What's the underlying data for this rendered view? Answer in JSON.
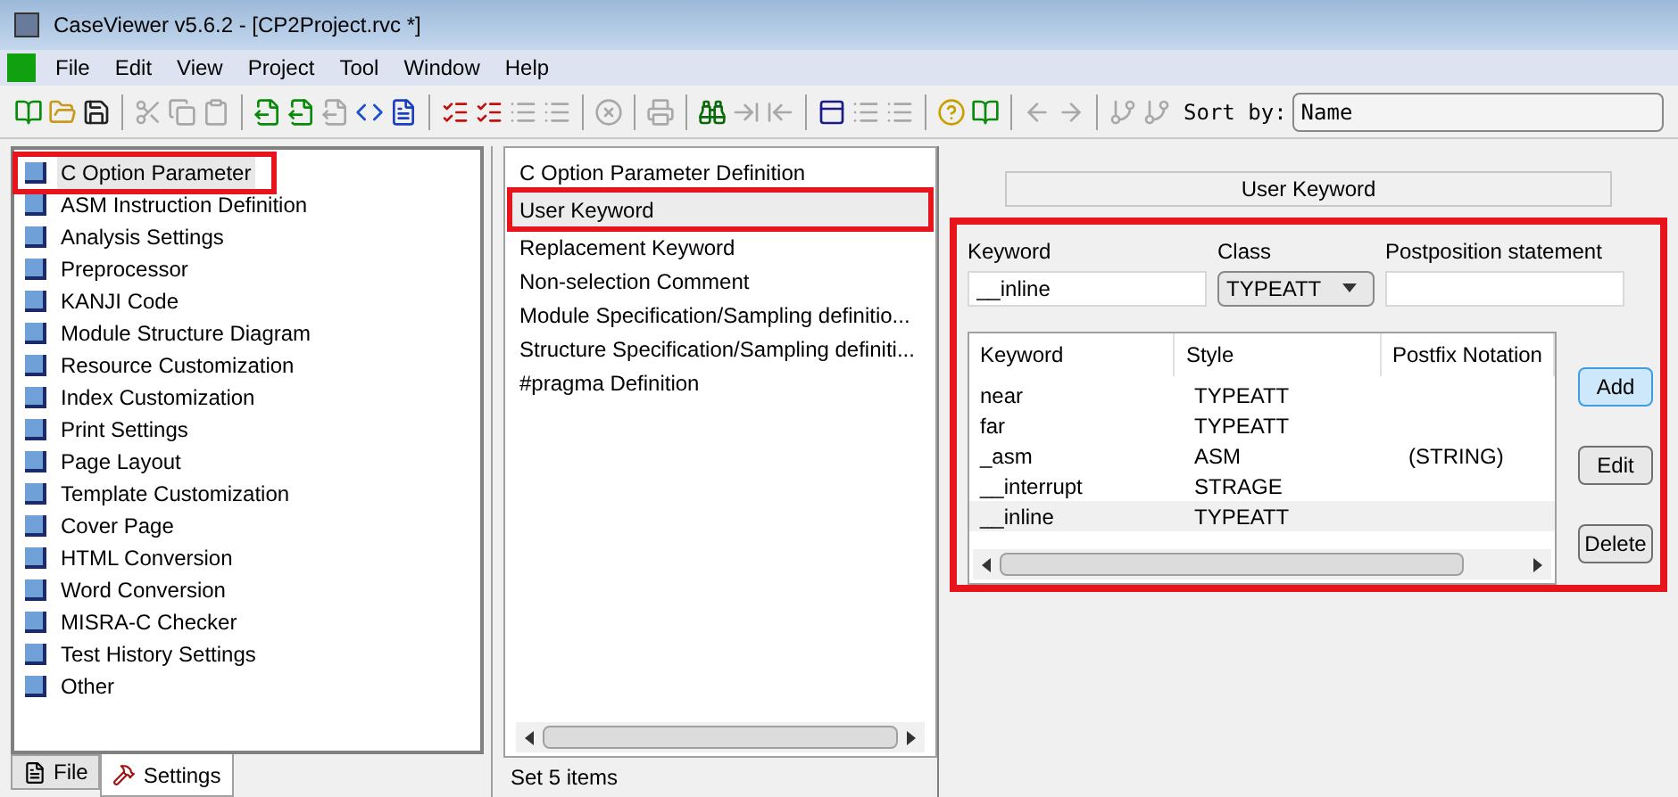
{
  "window": {
    "title": "CaseViewer v5.6.2 - [CP2Project.rvc *]"
  },
  "menu": [
    "File",
    "Edit",
    "View",
    "Project",
    "Tool",
    "Window",
    "Help"
  ],
  "toolbar": [
    {
      "kind": "book",
      "disabled": false
    },
    {
      "kind": "open",
      "disabled": false
    },
    {
      "kind": "save",
      "disabled": false
    },
    {
      "kind": "sep"
    },
    {
      "kind": "cut",
      "disabled": true
    },
    {
      "kind": "copy",
      "disabled": true
    },
    {
      "kind": "paste",
      "disabled": true
    },
    {
      "kind": "sep"
    },
    {
      "kind": "export",
      "disabled": false
    },
    {
      "kind": "export",
      "disabled": false
    },
    {
      "kind": "export",
      "disabled": true
    },
    {
      "kind": "html",
      "disabled": false
    },
    {
      "kind": "word",
      "disabled": false
    },
    {
      "kind": "sep"
    },
    {
      "kind": "check",
      "disabled": false
    },
    {
      "kind": "check",
      "disabled": false
    },
    {
      "kind": "list",
      "disabled": true
    },
    {
      "kind": "list",
      "disabled": true
    },
    {
      "kind": "sep"
    },
    {
      "kind": "stop",
      "disabled": true
    },
    {
      "kind": "sep"
    },
    {
      "kind": "print",
      "disabled": true
    },
    {
      "kind": "sep"
    },
    {
      "kind": "find",
      "disabled": false
    },
    {
      "kind": "next",
      "disabled": true
    },
    {
      "kind": "prev",
      "disabled": true
    },
    {
      "kind": "sep"
    },
    {
      "kind": "window",
      "disabled": false
    },
    {
      "kind": "list",
      "disabled": true
    },
    {
      "kind": "list",
      "disabled": true
    },
    {
      "kind": "sep"
    },
    {
      "kind": "help",
      "disabled": false
    },
    {
      "kind": "book",
      "disabled": false
    },
    {
      "kind": "sep"
    },
    {
      "kind": "back",
      "disabled": true
    },
    {
      "kind": "forward",
      "disabled": true
    },
    {
      "kind": "sep"
    },
    {
      "kind": "branch",
      "disabled": true
    },
    {
      "kind": "branch",
      "disabled": true
    }
  ],
  "sort": {
    "label": "Sort by:",
    "value": "Name"
  },
  "tree": {
    "items": [
      {
        "label": "C Option Parameter",
        "selected": true,
        "highlighted": true
      },
      {
        "label": "ASM Instruction Definition",
        "selected": false,
        "highlighted": false
      },
      {
        "label": "Analysis Settings",
        "selected": false,
        "highlighted": false
      },
      {
        "label": "Preprocessor",
        "selected": false,
        "highlighted": false
      },
      {
        "label": "KANJI Code",
        "selected": false,
        "highlighted": false
      },
      {
        "label": "Module Structure Diagram",
        "selected": false,
        "highlighted": false
      },
      {
        "label": "Resource Customization",
        "selected": false,
        "highlighted": false
      },
      {
        "label": "Index Customization",
        "selected": false,
        "highlighted": false
      },
      {
        "label": "Print Settings",
        "selected": false,
        "highlighted": false
      },
      {
        "label": "Page Layout",
        "selected": false,
        "highlighted": false
      },
      {
        "label": "Template Customization",
        "selected": false,
        "highlighted": false
      },
      {
        "label": "Cover Page",
        "selected": false,
        "highlighted": false
      },
      {
        "label": "HTML Conversion",
        "selected": false,
        "highlighted": false
      },
      {
        "label": "Word Conversion",
        "selected": false,
        "highlighted": false
      },
      {
        "label": "MISRA-C Checker",
        "selected": false,
        "highlighted": false
      },
      {
        "label": "Test History Settings",
        "selected": false,
        "highlighted": false
      },
      {
        "label": "Other",
        "selected": false,
        "highlighted": false
      }
    ]
  },
  "tabs": [
    {
      "label": "File",
      "kind": "file",
      "selected": false
    },
    {
      "label": "Settings",
      "kind": "hammer",
      "selected": true
    }
  ],
  "list": {
    "items": [
      {
        "label": "C Option Parameter Definition",
        "selected": false,
        "highlighted": false
      },
      {
        "label": "User Keyword",
        "selected": true,
        "highlighted": true
      },
      {
        "label": "Replacement Keyword",
        "selected": false,
        "highlighted": false
      },
      {
        "label": "Non-selection Comment",
        "selected": false,
        "highlighted": false
      },
      {
        "label": "Module Specification/Sampling definitio...",
        "selected": false,
        "highlighted": false
      },
      {
        "label": "Structure Specification/Sampling definiti...",
        "selected": false,
        "highlighted": false
      },
      {
        "label": "#pragma Definition",
        "selected": false,
        "highlighted": false
      }
    ]
  },
  "status_bar": "Set 5 items",
  "panel": {
    "title": "User Keyword",
    "highlighted": true,
    "fields": [
      {
        "label": "Keyword",
        "kind": "text",
        "value": "__inline"
      },
      {
        "label": "Class",
        "kind": "select",
        "value": "TYPEATT"
      },
      {
        "label": "Postposition statement",
        "kind": "text"
      }
    ],
    "table": {
      "columns": [
        "Keyword",
        "Style",
        "Postfix Notation"
      ],
      "rows": [
        {
          "cells": [
            "near",
            "TYPEATT",
            ""
          ],
          "selected": false
        },
        {
          "cells": [
            "far",
            "TYPEATT",
            ""
          ],
          "selected": false
        },
        {
          "cells": [
            "_asm",
            "ASM",
            "(STRING)"
          ],
          "selected": false
        },
        {
          "cells": [
            "__interrupt",
            "STRAGE",
            ""
          ],
          "selected": false
        },
        {
          "cells": [
            "__inline",
            "TYPEATT",
            ""
          ],
          "selected": true
        }
      ]
    },
    "buttons": [
      {
        "label": "Add",
        "default": true
      },
      {
        "label": "Edit",
        "default": false
      },
      {
        "label": "Delete",
        "default": false
      }
    ]
  }
}
